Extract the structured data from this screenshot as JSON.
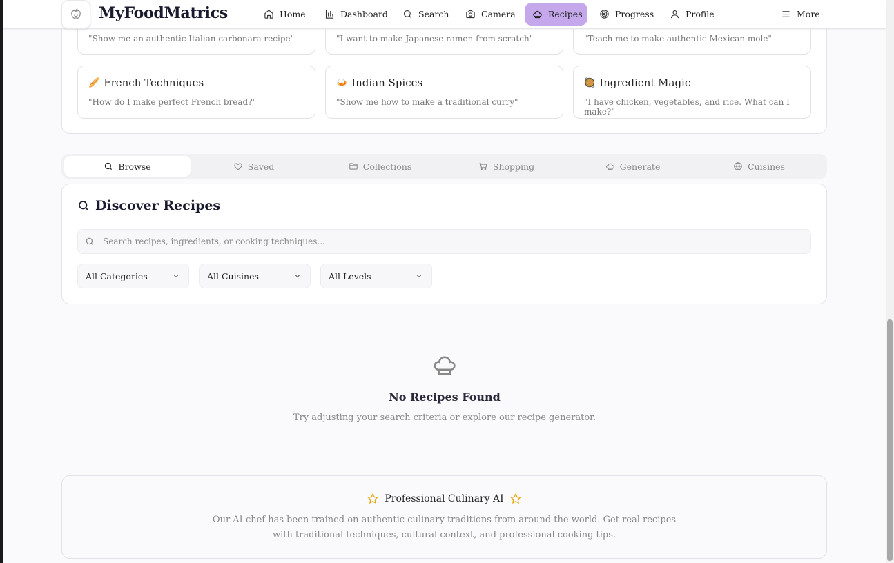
{
  "app": {
    "brand": "MyFoodMatrics"
  },
  "nav": {
    "items": [
      {
        "label": "Home",
        "icon": "home-icon"
      },
      {
        "label": "Dashboard",
        "icon": "bar-chart-icon"
      },
      {
        "label": "Search",
        "icon": "search-icon"
      },
      {
        "label": "Camera",
        "icon": "camera-icon"
      },
      {
        "label": "Recipes",
        "icon": "chef-hat-icon",
        "active": true
      },
      {
        "label": "Progress",
        "icon": "target-icon"
      },
      {
        "label": "Profile",
        "icon": "user-icon"
      },
      {
        "label": "More",
        "icon": "menu-icon"
      }
    ],
    "active_color": "#c5a8ec"
  },
  "prompts": [
    {
      "title": "",
      "text": "\"Show me an authentic Italian carbonara recipe\""
    },
    {
      "title": "",
      "text": "\"I want to make Japanese ramen from scratch\""
    },
    {
      "title": "",
      "text": "\"Teach me to make authentic Mexican mole\""
    },
    {
      "title": "French Techniques",
      "emoji": "🥖",
      "text": "\"How do I make perfect French bread?\""
    },
    {
      "title": "Indian Spices",
      "emoji": "🍛",
      "text": "\"Show me how to make a traditional curry\""
    },
    {
      "title": "Ingredient Magic",
      "emoji": "🥘",
      "text": "\"I have chicken, vegetables, and rice. What can I make?\""
    }
  ],
  "tabs": [
    {
      "label": "Browse",
      "icon": "search-icon",
      "active": true
    },
    {
      "label": "Saved",
      "icon": "heart-icon"
    },
    {
      "label": "Collections",
      "icon": "folder-icon"
    },
    {
      "label": "Shopping",
      "icon": "cart-icon"
    },
    {
      "label": "Generate",
      "icon": "chef-hat-icon"
    },
    {
      "label": "Cuisines",
      "icon": "globe-icon"
    }
  ],
  "discover": {
    "title": "Discover Recipes",
    "search_placeholder": "Search recipes, ingredients, or cooking techniques...",
    "search_value": "",
    "filters": [
      "All Categories",
      "All Cuisines",
      "All Levels"
    ]
  },
  "empty": {
    "title": "No Recipes Found",
    "text": "Try adjusting your search criteria or explore our recipe generator."
  },
  "pro": {
    "title": "Professional Culinary AI",
    "line1": "Our AI chef has been trained on authentic culinary traditions from around the world. Get real recipes",
    "line2": "with traditional techniques, cultural context, and professional cooking tips.",
    "star_color": "#e6a817"
  }
}
